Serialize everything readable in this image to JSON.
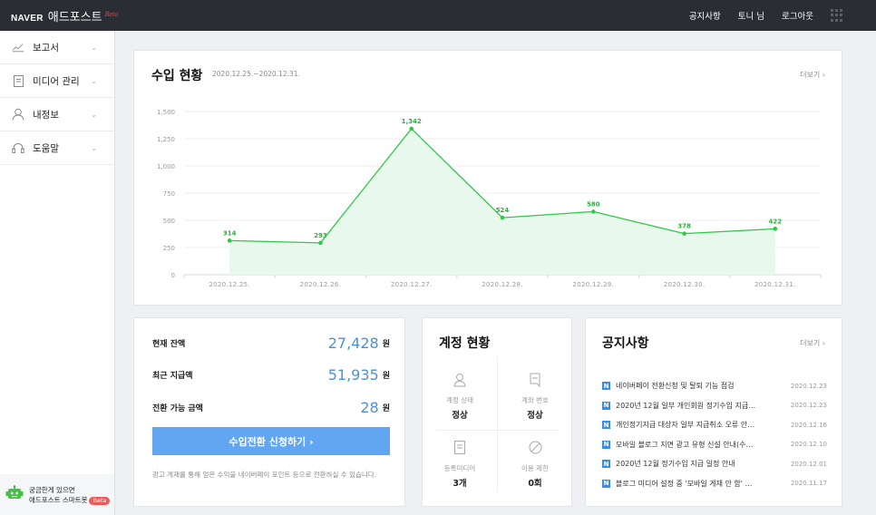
{
  "header": {
    "brand": "NAVER",
    "app_name": "애드포스트",
    "beta": "Beta",
    "nav": [
      "공지사항",
      "토니 님",
      "로그아웃"
    ]
  },
  "sidebar": {
    "items": [
      {
        "label": "보고서",
        "icon": "chart-line-icon"
      },
      {
        "label": "미디어 관리",
        "icon": "document-icon"
      },
      {
        "label": "내정보",
        "icon": "person-icon"
      },
      {
        "label": "도움말",
        "icon": "headset-icon"
      }
    ],
    "help_line1": "궁금한게 있으면",
    "help_line2": "애드포스트 스마트봇",
    "help_badge": "Beta"
  },
  "income": {
    "title": "수입 현황",
    "date_range": "2020.12.25.~2020.12.31.",
    "more": "더보기 ›"
  },
  "chart_data": {
    "type": "area",
    "categories": [
      "2020.12.25.",
      "2020.12.26.",
      "2020.12.27.",
      "2020.12.28.",
      "2020.12.29.",
      "2020.12.30.",
      "2020.12.31."
    ],
    "values": [
      314,
      293,
      1342,
      524,
      580,
      378,
      422
    ],
    "data_labels": [
      "314",
      "293",
      "1,342",
      "524",
      "580",
      "378",
      "422"
    ],
    "y_ticks": [
      "0",
      "250",
      "500",
      "750",
      "1,000",
      "1,250",
      "1,500"
    ],
    "ylim": [
      0,
      1500
    ],
    "grid": true,
    "line_color": "#2fc84a",
    "fill_color": "#e9f8ec"
  },
  "balance": {
    "rows": [
      {
        "label": "현재 잔액",
        "value": "27,428",
        "unit": "원"
      },
      {
        "label": "최근 지급액",
        "value": "51,935",
        "unit": "원"
      },
      {
        "label": "전환 가능 금액",
        "value": "28",
        "unit": "원"
      }
    ],
    "button": "수입전환 신청하기  ›",
    "note": "광고 게재를 통해 얻은 수익을 네이버페이 포인트 등으로 전환하실 수 있습니다."
  },
  "account": {
    "title": "계정 현황",
    "cells": [
      {
        "label": "계정 상태",
        "value": "정상",
        "icon": "person-icon"
      },
      {
        "label": "계좌 번호",
        "value": "정상",
        "icon": "bookmark-icon"
      },
      {
        "label": "등록미디어",
        "value": "3개",
        "icon": "document-icon"
      },
      {
        "label": "이용 제한",
        "value": "0회",
        "icon": "prohibited-icon"
      }
    ]
  },
  "notices": {
    "title": "공지사항",
    "more": "더보기 ›",
    "badge": "N",
    "items": [
      {
        "title": "네이버페이 전환신청 및 탈퇴 기능 점검",
        "date": "2020.12.23"
      },
      {
        "title": "2020년 12월 일부 개인회원 정기수입 지급…",
        "date": "2020.12.23"
      },
      {
        "title": "개인정기지급 대상자 일부 지급취소 오류 안…",
        "date": "2020.12.16"
      },
      {
        "title": "모바일 블로그 지면 광고 유형 신설 안내(수…",
        "date": "2020.12.10"
      },
      {
        "title": "2020년 12월 정기수입 지급 일정 안내",
        "date": "2020.12.01"
      },
      {
        "title": "블로그 미디어 설정 중 '모바일 게재 안 함' …",
        "date": "2020.11.17"
      }
    ]
  }
}
